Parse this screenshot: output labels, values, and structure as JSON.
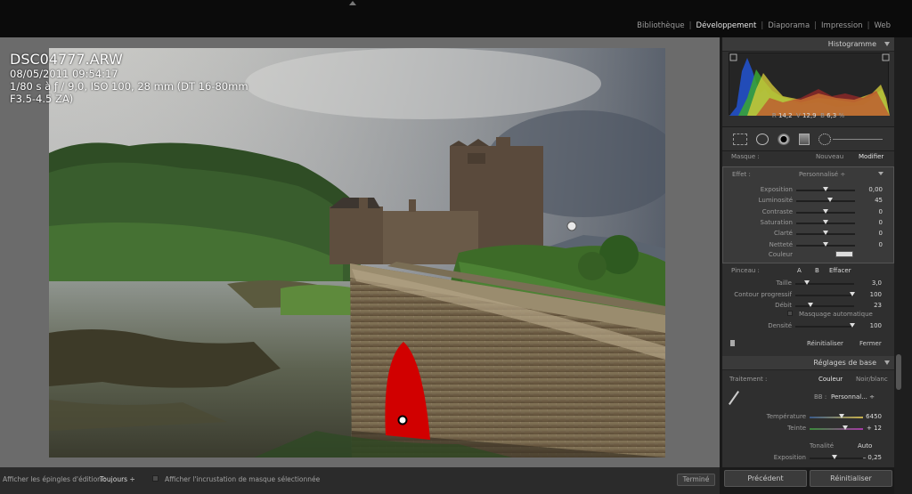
{
  "modules": [
    "Bibliothèque",
    "Développement",
    "Diaporama",
    "Impression",
    "Web"
  ],
  "active_module": "Développement",
  "photo_info": {
    "filename": "DSC04777.ARW",
    "datetime": "08/05/2011 09:54:17",
    "exposure": "1/80 s à ƒ / 9,0, ISO 100, 28 mm (DT 16-80mm F3.5-4.5 ZA)"
  },
  "histogram": {
    "title": "Histogramme",
    "r_label": "R",
    "r_value": "14,2",
    "v_label": "V",
    "v_value": "12,9",
    "b_label": "B",
    "b_value": "6,3",
    "unit": "%"
  },
  "mask": {
    "label": "Masque :",
    "new_label": "Nouveau",
    "edit_label": "Modifier"
  },
  "effect": {
    "label": "Effet :",
    "preset": "Personnalisé ÷",
    "sliders": [
      {
        "name": "Exposition",
        "value": "0,00",
        "pos": 0.5
      },
      {
        "name": "Luminosité",
        "value": "45",
        "pos": 0.58
      },
      {
        "name": "Contraste",
        "value": "0",
        "pos": 0.5
      },
      {
        "name": "Saturation",
        "value": "0",
        "pos": 0.5
      },
      {
        "name": "Clarté",
        "value": "0",
        "pos": 0.5
      },
      {
        "name": "Netteté",
        "value": "0",
        "pos": 0.5
      }
    ],
    "color_label": "Couleur"
  },
  "brush": {
    "label": "Pinceau :",
    "a_label": "A",
    "b_label": "B",
    "erase_label": "Effacer",
    "sliders": [
      {
        "name": "Taille",
        "value": "3,0",
        "pos": 0.2
      },
      {
        "name": "Contour progressif",
        "value": "100",
        "pos": 0.97
      },
      {
        "name": "Débit",
        "value": "23",
        "pos": 0.25
      }
    ],
    "automask_label": "Masquage automatique",
    "density": {
      "name": "Densité",
      "value": "100",
      "pos": 0.97
    }
  },
  "tool_actions": {
    "reset_label": "Réinitialiser",
    "close_label": "Fermer"
  },
  "basic": {
    "title": "Réglages de base",
    "treatment_label": "Traitement :",
    "color_label": "Couleur",
    "bw_label": "Noir/blanc",
    "wb_label": "BB :",
    "wb_value": "Personnal... ÷",
    "temp_label": "Température",
    "temp_value": "6450",
    "temp_pos": 0.6,
    "tint_label": "Teinte",
    "tint_value": "+ 12",
    "tint_pos": 0.67,
    "tone_label": "Tonalité",
    "auto_label": "Auto",
    "exposure_label": "Exposition",
    "exposure_value": "– 0,25",
    "exposure_pos": 0.47
  },
  "bottom": {
    "pins_label": "Afficher les épingles d'édition :",
    "pins_value": "Toujours ÷",
    "overlay_label": "Afficher l'incrustation de masque sélectionnée",
    "done_label": "Terminé"
  },
  "nav": {
    "prev_label": "Précédent",
    "reset_label": "Réinitialiser"
  }
}
